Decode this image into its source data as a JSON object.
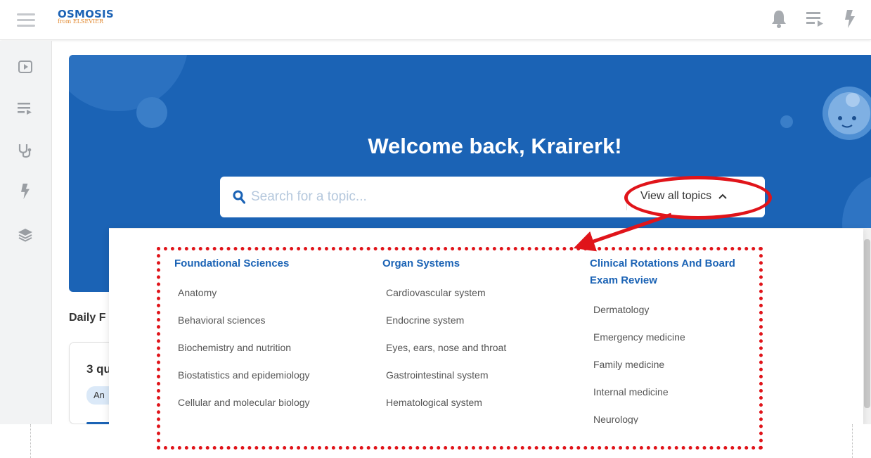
{
  "brand": {
    "logo_text": "OSMOSIS",
    "logo_subtext": "from ELSEVIER",
    "color_primary": "#1b63b5",
    "color_accent": "#5bc14a"
  },
  "topbar": {
    "icons": [
      "hamburger-menu-icon",
      "bell-icon",
      "playlist-icon",
      "lightning-icon"
    ]
  },
  "sidebar": {
    "items": [
      {
        "icon": "video-icon"
      },
      {
        "icon": "playlist-icon"
      },
      {
        "icon": "stethoscope-icon"
      },
      {
        "icon": "lightning-icon"
      },
      {
        "icon": "layers-icon"
      }
    ]
  },
  "hero": {
    "welcome": "Welcome back, Krairerk!",
    "search_placeholder": "Search for a topic...",
    "view_all": "View all topics"
  },
  "behind": {
    "daily_label": "Daily F",
    "card_title": "3 qu",
    "card_tag": "An"
  },
  "dropdown": {
    "columns": [
      {
        "heading": "Foundational Sciences",
        "items": [
          "Anatomy",
          "Behavioral sciences",
          "Biochemistry and nutrition",
          "Biostatistics and epidemiology",
          "Cellular and molecular biology"
        ]
      },
      {
        "heading": "Organ Systems",
        "items": [
          "Cardiovascular system",
          "Endocrine system",
          "Eyes, ears, nose and throat",
          "Gastrointestinal system",
          "Hematological system"
        ]
      },
      {
        "heading": "Clinical Rotations And Board Exam Review",
        "items": [
          "Dermatology",
          "Emergency medicine",
          "Family medicine",
          "Internal medicine",
          "Neurology"
        ]
      }
    ]
  },
  "annotation": {
    "color": "#e0141a"
  }
}
